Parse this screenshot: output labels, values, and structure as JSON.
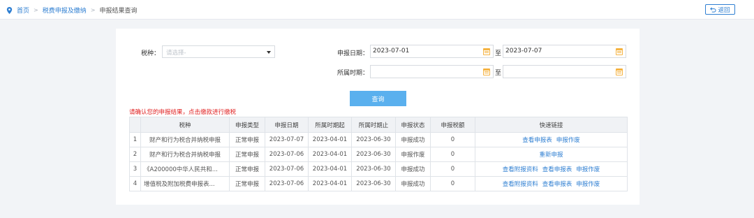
{
  "breadcrumb": {
    "home": "首页",
    "level2": "税费申报及缴纳",
    "current": "申报结果查询",
    "separator": ">"
  },
  "back_button": {
    "label": "返回",
    "icon": "return-icon"
  },
  "form": {
    "tax_type_label": "税种：",
    "tax_type_placeholder": "请选择-",
    "declare_date_label": "申报日期：",
    "declare_date_start": "2023-07-01",
    "declare_date_end": "2023-07-07",
    "period_label": "所属时期：",
    "period_start": "",
    "period_end": "",
    "to": "至",
    "query_button": "查询"
  },
  "tip": "请确认您的申报结果，点击缴款进行缴税",
  "table": {
    "headers": [
      "",
      "税种",
      "申报类型",
      "申报日期",
      "所属时期起",
      "所属时期止",
      "申报状态",
      "申报税额",
      "快速链接"
    ],
    "rows": [
      {
        "no": "1",
        "tax": "财产和行为税合并纳税申报",
        "type": "正常申报",
        "date": "2023-07-07",
        "start": "2023-04-01",
        "end": "2023-06-30",
        "status": "申报成功",
        "amount": "0",
        "links": [
          "查看申报表",
          "申报作废"
        ]
      },
      {
        "no": "2",
        "tax": "财产和行为税合并纳税申报",
        "type": "正常申报",
        "date": "2023-07-06",
        "start": "2023-04-01",
        "end": "2023-06-30",
        "status": "申报作废",
        "amount": "0",
        "links": [
          "重新申报"
        ]
      },
      {
        "no": "3",
        "tax": "《A200000中华人民共和...",
        "type": "正常申报",
        "date": "2023-07-06",
        "start": "2023-04-01",
        "end": "2023-06-30",
        "status": "申报成功",
        "amount": "0",
        "links": [
          "查看附报资料",
          "查看申报表",
          "申报作废"
        ]
      },
      {
        "no": "4",
        "tax": "增值税及附加税费申报表...",
        "type": "正常申报",
        "date": "2023-07-06",
        "start": "2023-04-01",
        "end": "2023-06-30",
        "status": "申报成功",
        "amount": "0",
        "links": [
          "查看附报资料",
          "查看申报表",
          "申报作废"
        ]
      }
    ]
  },
  "colors": {
    "link": "#2f7fd2",
    "button": "#5ab0ee",
    "tip": "#e02020",
    "calendar": "#f5b342"
  }
}
